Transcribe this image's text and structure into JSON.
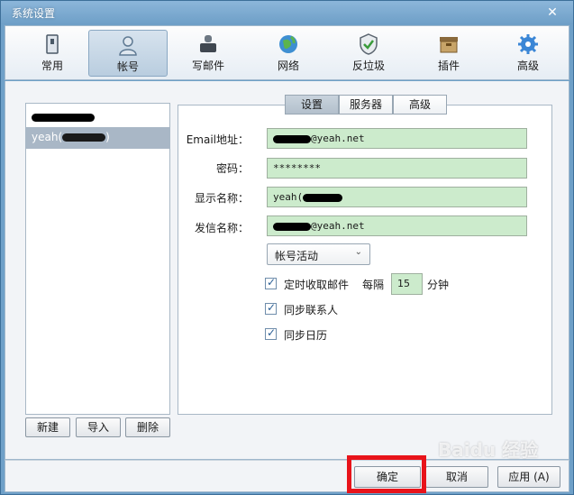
{
  "window": {
    "title": "系统设置"
  },
  "toolbar": {
    "items": [
      {
        "label": "常用",
        "icon": "general-icon"
      },
      {
        "label": "帐号",
        "icon": "account-icon",
        "active": true
      },
      {
        "label": "写邮件",
        "icon": "compose-icon"
      },
      {
        "label": "网络",
        "icon": "network-icon"
      },
      {
        "label": "反垃圾",
        "icon": "antispam-icon"
      },
      {
        "label": "插件",
        "icon": "plugin-icon"
      },
      {
        "label": "高级",
        "icon": "advanced-icon"
      }
    ]
  },
  "accounts": {
    "items": [
      {
        "label": ""
      },
      {
        "label": "yeah(",
        "suffix": ")"
      }
    ],
    "buttons": {
      "new": "新建",
      "import": "导入",
      "delete": "删除"
    }
  },
  "tabs": [
    "设置",
    "服务器",
    "高级"
  ],
  "form": {
    "email_label": "Email地址：",
    "email_value": "@yeah.net",
    "password_label": "密码：",
    "password_value": "********",
    "display_name_label": "显示名称：",
    "display_name_value": "yeah(",
    "sender_name_label": "发信名称：",
    "sender_name_value": "@yeah.net",
    "status_select": "帐号活动",
    "checkbox_fetch": "定时收取邮件",
    "interval_prefix": "每隔",
    "interval_value": "15",
    "interval_unit": "分钟",
    "checkbox_contacts": "同步联系人",
    "checkbox_calendar": "同步日历"
  },
  "footer": {
    "ok": "确定",
    "cancel": "取消",
    "apply": "应用 (A)"
  },
  "watermark": "Baidu 经验",
  "colors": {
    "field_bg": "#ccebcc",
    "highlight": "#e8131a",
    "selected_row": "#a9b7c6"
  }
}
